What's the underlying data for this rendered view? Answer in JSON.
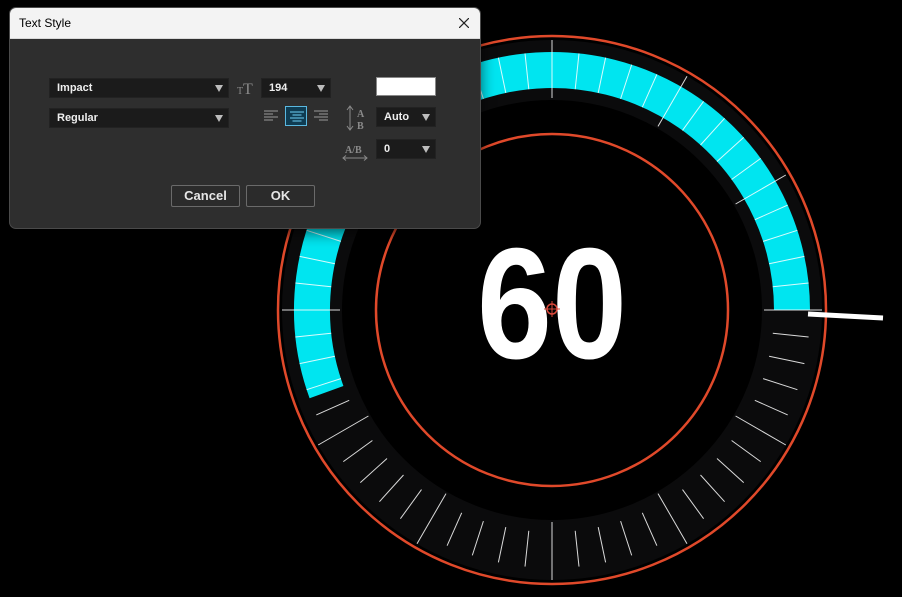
{
  "dialog": {
    "title": "Text Style",
    "font_family": "Impact",
    "font_style": "Regular",
    "font_size": "194",
    "text_color": "#FFFFFF",
    "leading": "Auto",
    "tracking": "0",
    "alignment": "center",
    "cancel_label": "Cancel",
    "ok_label": "OK"
  },
  "canvas": {
    "timer_text": "60",
    "accent_color": "#00E5F0",
    "ring_color": "#E0492A",
    "background": "#000000",
    "tick_color": "#FFFFFF"
  }
}
